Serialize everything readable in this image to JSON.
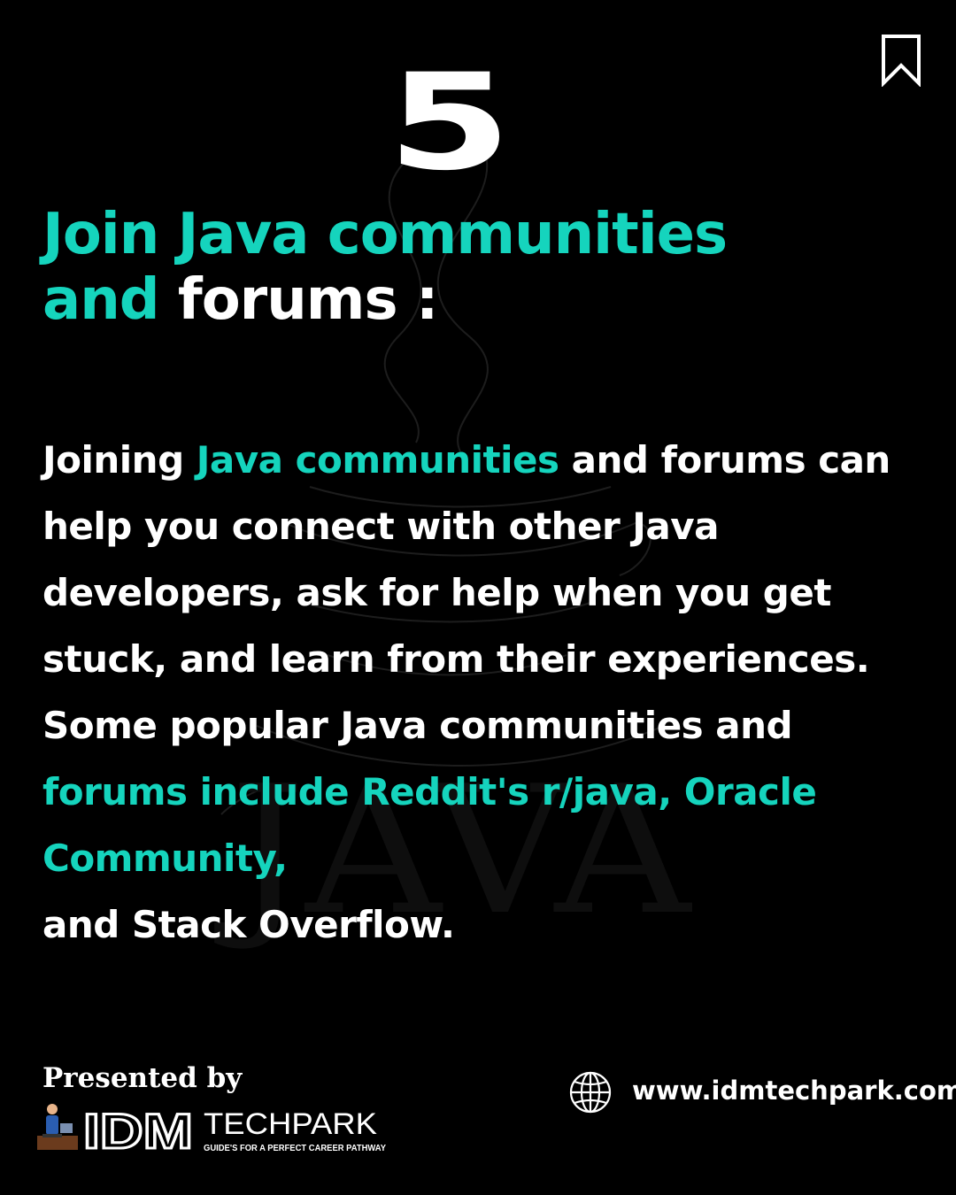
{
  "step_number": "5",
  "heading": {
    "part1": "Join Java communities",
    "part2_teal": "and",
    "part2_white": "forums :"
  },
  "body": {
    "seg1": "Joining ",
    "seg2_teal": "Java communities",
    "seg3": " and forums can help you connect with other Java developers, ask for help when you get stuck, and learn from their experiences. Some popular Java communities and ",
    "seg4_teal": "forums include Reddit's r/java, Oracle Community,",
    "seg5": "and Stack Overflow."
  },
  "footer": {
    "presented_by": "Presented by",
    "logo_idm": "IDM",
    "logo_techpark": "TECHPARK",
    "logo_tagline": "GUIDE'S FOR A PERFECT CAREER PATHWAY",
    "website": "www.idmtechpark.com"
  },
  "watermark": "JAVA",
  "icons": {
    "bookmark": "bookmark-icon",
    "globe": "globe-icon",
    "mascot": "person-at-laptop-icon"
  },
  "colors": {
    "accent": "#15d4bd",
    "background": "#000000",
    "text": "#ffffff"
  }
}
